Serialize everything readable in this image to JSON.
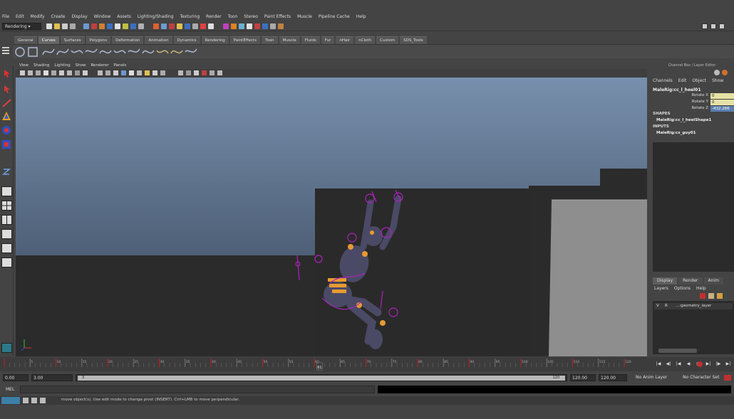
{
  "menubar": {
    "items": [
      "File",
      "Edit",
      "Modify",
      "Create",
      "Display",
      "Window",
      "Assets",
      "Lighting/Shading",
      "Texturing",
      "Render",
      "Toon",
      "Stereo",
      "Paint Effects",
      "Muscle",
      "Pipeline Cache",
      "Help"
    ]
  },
  "statusline": {
    "mode": "Rendering"
  },
  "shelf": {
    "tabs": [
      "General",
      "Curves",
      "Surfaces",
      "Polygons",
      "Deformation",
      "Animation",
      "Dynamics",
      "Rendering",
      "PaintEffects",
      "Toon",
      "Muscle",
      "Fluids",
      "Fur",
      "nHair",
      "nCloth",
      "Custom",
      "SDS_Tools"
    ],
    "active_tab": "Curves"
  },
  "panel": {
    "menus": [
      "View",
      "Shading",
      "Lighting",
      "Show",
      "Renderer",
      "Panels"
    ]
  },
  "channel_box": {
    "title": "Channel Box / Layer Editor",
    "menus": [
      "Channels",
      "Edit",
      "Object",
      "Show"
    ],
    "object_name": "MaleRig:cc_l_heel01",
    "attributes": [
      {
        "label": "Rotate X",
        "value": "0"
      },
      {
        "label": "Rotate Y",
        "value": "0"
      },
      {
        "label": "Rotate Z",
        "value": "-432.286"
      }
    ],
    "shapes_header": "SHAPES",
    "shape_name": "MaleRig:cc_l_heelShape1",
    "inputs_header": "INPUTS",
    "input_name": "MaleRig:cs_guy01"
  },
  "layer_editor": {
    "tabs": [
      "Display",
      "Render",
      "Anim"
    ],
    "active_tab": "Display",
    "menus": [
      "Layers",
      "Options",
      "Help"
    ],
    "layers": [
      {
        "v": "V",
        "r": "R",
        "name": "...:geometry_layer"
      }
    ]
  },
  "timeline": {
    "current_frame": "61",
    "tick_labels": [
      "5",
      "10",
      "15",
      "20",
      "25",
      "30",
      "35",
      "40",
      "45",
      "50",
      "55",
      "60",
      "65",
      "70",
      "75",
      "80",
      "85",
      "90",
      "95",
      "100",
      "105",
      "110",
      "115",
      "120"
    ]
  },
  "range": {
    "start": "0.00",
    "inner_start": "3.00",
    "slider_start": "3",
    "slider_end": "120",
    "inner_end": "120.00",
    "end": "120.00",
    "anim_layer": "No Anim Layer",
    "character_set": "No Character Set"
  },
  "command_line": {
    "label": "MEL"
  },
  "help_line": {
    "text": "move object(s). Use edit mode to change pivot (INSERT).  Ctrl+LMB to move perpendicular."
  },
  "colors": {
    "ui_bg": "#444444",
    "viewport_sky_top": "#7890ad",
    "viewport_ground": "#2b2b2b",
    "rig_purple": "#b020c0",
    "rig_orange": "#e89a30",
    "rig_body": "#4a4a66",
    "keyframe_red": "#c02020",
    "attr_highlight": "#e6e2a6"
  }
}
